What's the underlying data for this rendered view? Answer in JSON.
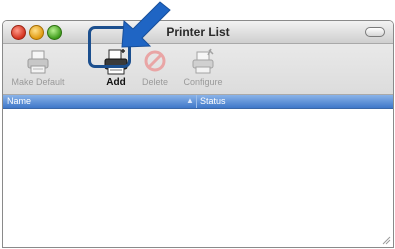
{
  "window": {
    "title": "Printer List"
  },
  "toolbar": {
    "make_default_label": "Make Default",
    "add_label": "Add",
    "delete_label": "Delete",
    "configure_label": "Configure"
  },
  "table": {
    "columns": [
      "Name",
      "Status"
    ],
    "sorted_column": "Name",
    "rows": []
  },
  "icons": {
    "make_default": "printer-icon",
    "add": "printer-add-icon",
    "delete": "delete-icon",
    "configure": "configure-icon",
    "pointer": "blue-arrow-icon"
  },
  "colors": {
    "header_blue": "#3f78c9",
    "highlight": "#1c4f8e",
    "arrow": "#1f65c4"
  }
}
